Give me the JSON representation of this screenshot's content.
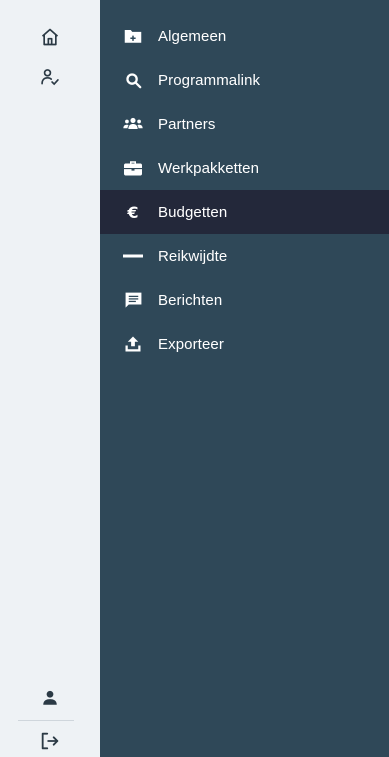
{
  "rail": {
    "top_icons": [
      {
        "name": "home-icon"
      },
      {
        "name": "user-check-icon"
      }
    ],
    "bottom_icons": [
      {
        "name": "user-icon"
      },
      {
        "name": "logout-icon"
      }
    ]
  },
  "menu": {
    "items": [
      {
        "label": "Algemeen",
        "icon": "folder-plus-icon",
        "active": false
      },
      {
        "label": "Programmalink",
        "icon": "search-icon",
        "active": false
      },
      {
        "label": "Partners",
        "icon": "users-icon",
        "active": false
      },
      {
        "label": "Werkpakketten",
        "icon": "briefcase-icon",
        "active": false
      },
      {
        "label": "Budgetten",
        "icon": "euro-icon",
        "active": true
      },
      {
        "label": "Reikwijdte",
        "icon": "minus-icon",
        "active": false
      },
      {
        "label": "Berichten",
        "icon": "message-icon",
        "active": false
      },
      {
        "label": "Exporteer",
        "icon": "upload-icon",
        "active": false
      }
    ]
  },
  "colors": {
    "rail_bg": "#eef2f5",
    "menu_bg": "#2f4858",
    "active_bg": "#23283a",
    "text": "#ffffff"
  }
}
